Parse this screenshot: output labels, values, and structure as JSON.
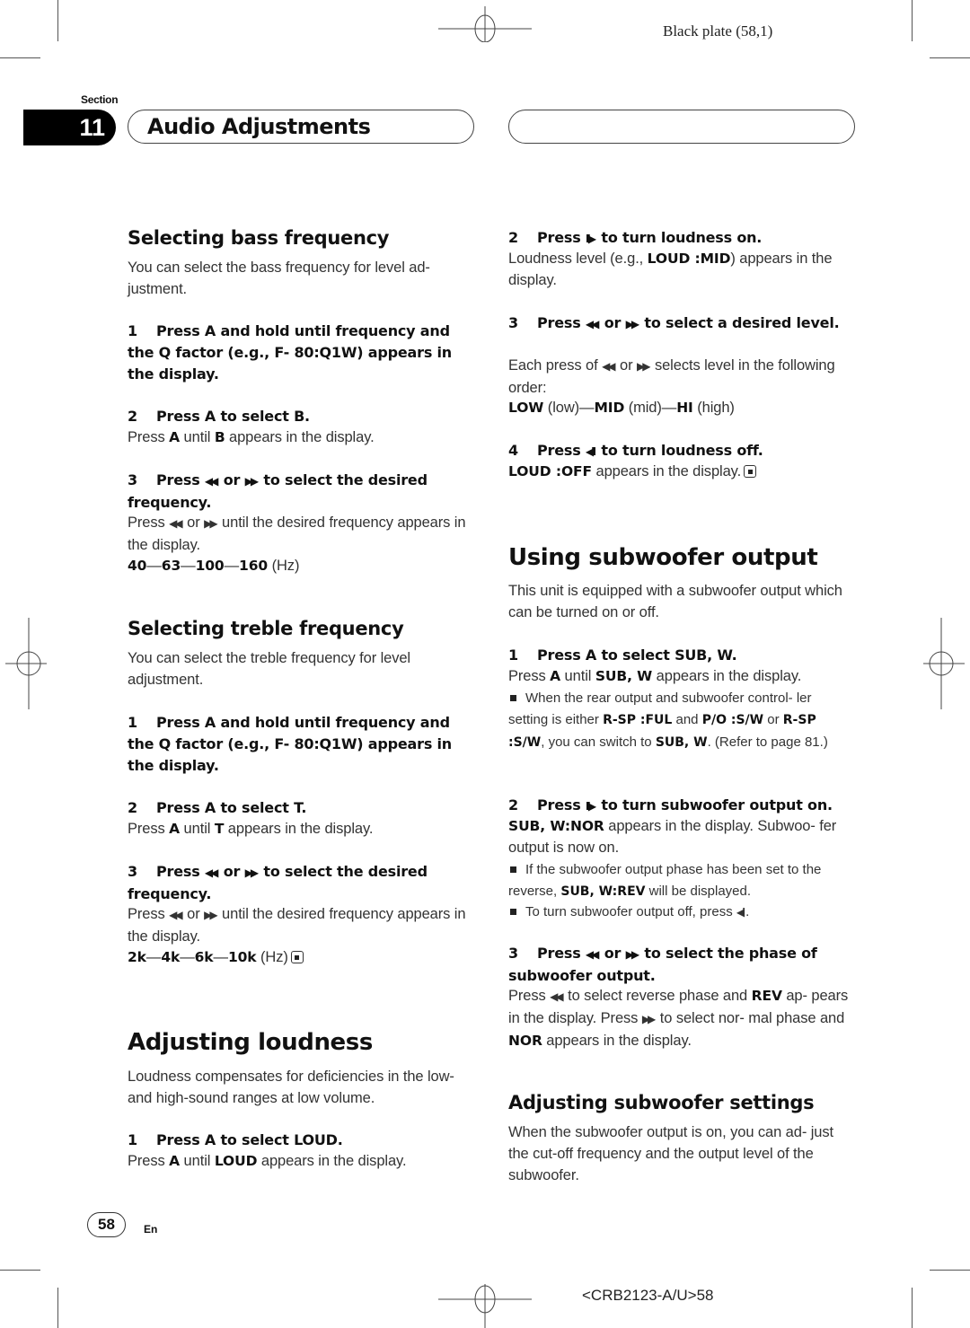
{
  "print_marks": {
    "plate_label": "Black plate (58,1)",
    "job_code": "<CRB2123-A/U>58"
  },
  "header": {
    "section_label": "Section",
    "section_number": "11",
    "section_title": "Audio Adjustments"
  },
  "icons": {
    "rewind": "◀◀",
    "forward": "▶▶",
    "play_pause": "II▶",
    "back_pause": "◀II",
    "end_mark": "end-of-section-mark",
    "bullet": "square-bullet"
  },
  "left_column": {
    "bass": {
      "heading": "Selecting bass frequency",
      "intro": "You can select the bass frequency for level ad- justment.",
      "step1_num": "1",
      "step1_text": "Press A and hold until frequency and the Q factor (e.g., F- 80:Q1W) appears in the display.",
      "step2_num": "2",
      "step2_text": "Press A to select B.",
      "step2_body": {
        "pre": "Press ",
        "b1": "A",
        "mid": " until ",
        "b2": "B",
        "post": " appears in the display."
      },
      "step3_num": "3",
      "step3_pre": "Press ",
      "step3_or": " or ",
      "step3_post": " to select the desired frequency.",
      "step3_body_pre": "Press ",
      "step3_body_or": " or ",
      "step3_body_post": " until the desired frequency appears in the display.",
      "frequencies": [
        "40",
        "63",
        "100",
        "160"
      ],
      "unit": "(Hz)"
    },
    "treble": {
      "heading": "Selecting treble frequency",
      "intro": "You can select the treble frequency for level adjustment.",
      "step1_num": "1",
      "step1_text": "Press A and hold until frequency and the Q factor (e.g., F- 80:Q1W) appears in the display.",
      "step2_num": "2",
      "step2_text": "Press A to select T.",
      "step2_body": {
        "pre": "Press ",
        "b1": "A",
        "mid": " until ",
        "b2": "T",
        "post": " appears in the display."
      },
      "step3_num": "3",
      "step3_pre": "Press ",
      "step3_or": " or ",
      "step3_post": " to select the desired frequency.",
      "step3_body_pre": "Press ",
      "step3_body_or": " or ",
      "step3_body_post": " until the desired frequency appears in the display.",
      "frequencies": [
        "2k",
        "4k",
        "6k",
        "10k"
      ],
      "unit": "(Hz)"
    },
    "loudness": {
      "heading": "Adjusting loudness",
      "intro": "Loudness compensates for deficiencies in the low- and high-sound ranges at low volume.",
      "step1_num": "1",
      "step1_text": "Press A to select LOUD.",
      "step1_body": {
        "pre": "Press ",
        "b1": "A",
        "mid": " until ",
        "b2": "LOUD",
        "post": " appears in the display."
      }
    }
  },
  "right_column": {
    "loudness_cont": {
      "step2_num": "2",
      "step2_pre": "Press ",
      "step2_post": " to turn loudness on.",
      "step2_body": {
        "pre": "Loudness level (e.g., ",
        "b1": "LOUD :MID",
        "post": ") appears in the display."
      },
      "step3_num": "3",
      "step3_pre": "Press ",
      "step3_or": " or ",
      "step3_post": " to select a desired level.",
      "step3_body_pre": "Each press of ",
      "step3_body_or": " or ",
      "step3_body_post": " selects level in the following order:",
      "levels": [
        {
          "code": "LOW",
          "desc": "(low)"
        },
        {
          "code": "MID",
          "desc": "(mid)"
        },
        {
          "code": "HI",
          "desc": "(high)"
        }
      ],
      "step4_num": "4",
      "step4_pre": "Press ",
      "step4_post": " to turn loudness off.",
      "step4_body": {
        "b1": "LOUD :OFF",
        "post": " appears in the display."
      }
    },
    "subwoofer": {
      "heading": "Using subwoofer output",
      "intro": "This unit is equipped with a subwoofer output which can be turned on or off.",
      "step1_num": "1",
      "step1_text": "Press A to select SUB, W.",
      "step1_body": {
        "pre": "Press ",
        "b1": "A",
        "mid": " until ",
        "b2": "SUB, W",
        "post": " appears in the display."
      },
      "note1": {
        "t1": "When the rear output and subwoofer control- ler setting is either ",
        "b1": "R-SP :FUL",
        "t2": " and ",
        "b2": "P/O  :S/W",
        "t3": " or ",
        "b3": "R-SP :S/W",
        "t4": ", you can switch to ",
        "b4": "SUB, W",
        "t5": ". (Refer to page 81.)"
      },
      "step2_num": "2",
      "step2_pre": "Press ",
      "step2_post": " to turn subwoofer output on.",
      "step2_body": {
        "b1": "SUB, W:NOR",
        "post": " appears in the display. Subwoo- fer output is now on."
      },
      "note2": {
        "t1": "If the subwoofer output phase has been set to the reverse, ",
        "b1": "SUB, W:REV",
        "t2": " will be displayed."
      },
      "note3": {
        "t1": "To turn subwoofer output off, press ",
        "t2": "."
      },
      "step3_num": "3",
      "step3_pre": "Press ",
      "step3_or": " or ",
      "step3_post": " to select the phase of subwoofer output.",
      "step3_body": {
        "t1": "Press ",
        "t2": " to select reverse phase and ",
        "b1": "REV",
        "t3": " ap- pears in the display. Press ",
        "t4": " to select nor- mal phase and ",
        "b2": "NOR",
        "t5": " appears in the display."
      }
    },
    "subwoofer_settings": {
      "heading": "Adjusting subwoofer settings",
      "intro": "When the subwoofer output is on, you can ad- just the cut-off frequency and the output level of the subwoofer."
    }
  },
  "footer": {
    "page_number": "58",
    "language": "En"
  }
}
